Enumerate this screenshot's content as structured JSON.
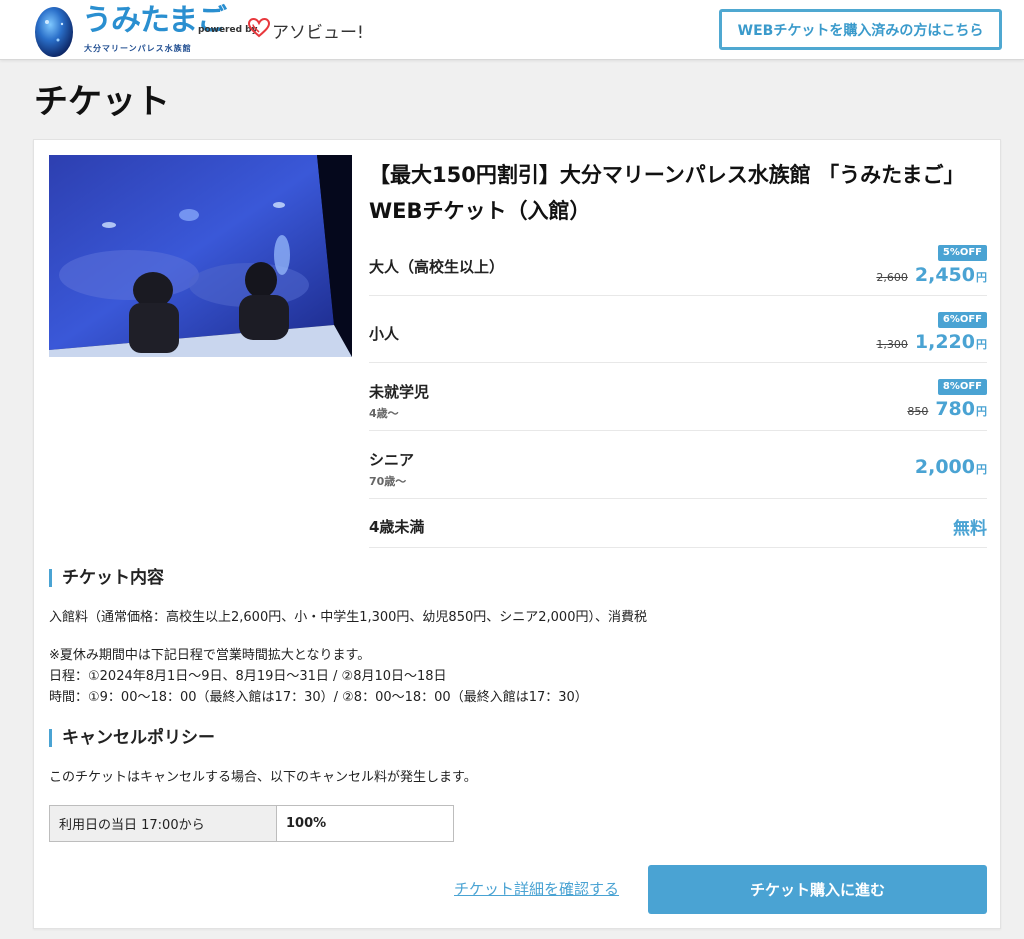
{
  "header": {
    "logo_text": "うみたまご",
    "logo_sub": "大分マリーンパレス水族館",
    "powered_by": "powered by",
    "asoview": "アソビュー!",
    "purchased_button": "WEBチケットを購入済みの方はこちら"
  },
  "page_title": "チケット",
  "product": {
    "title": "【最大150円割引】大分マリーンパレス水族館 「うみたまご」 WEBチケット（入館）",
    "prices": [
      {
        "label": "大人（高校生以上）",
        "sub": "",
        "badge": "5%OFF",
        "original": "2,600",
        "price": "2,450",
        "yen": "円"
      },
      {
        "label": "小人",
        "sub": "",
        "badge": "6%OFF",
        "original": "1,300",
        "price": "1,220",
        "yen": "円"
      },
      {
        "label": "未就学児",
        "sub": "4歳〜",
        "badge": "8%OFF",
        "original": "850",
        "price": "780",
        "yen": "円"
      },
      {
        "label": "シニア",
        "sub": "70歳〜",
        "badge": "",
        "original": "",
        "price": "2,000",
        "yen": "円"
      },
      {
        "label": "4歳未満",
        "sub": "",
        "badge": "",
        "original": "",
        "price": "無料",
        "yen": ""
      }
    ]
  },
  "ticket_contents": {
    "heading": "チケット内容",
    "line1": "入館料（通常価格：高校生以上2,600円、小・中学生1,300円、幼児850円、シニア2,000円）、消費税",
    "line2": "※夏休み期間中は下記日程で営業時間拡大となります。",
    "line3": "日程：①2024年8月1日〜9日、8月19日〜31日 / ②8月10日〜18日",
    "line4": "時間：①9：00〜18：00（最終入館は17：30）/ ②8：00〜18：00（最終入館は17：30）"
  },
  "cancel_policy": {
    "heading": "キャンセルポリシー",
    "text": "このチケットはキャンセルする場合、以下のキャンセル料が発生します。",
    "row_label": "利用日の当日 17:00から",
    "row_value": "100%"
  },
  "actions": {
    "detail_link": "チケット詳細を確認する",
    "buy_button": "チケット購入に進む"
  },
  "colors": {
    "accent": "#4aa3d3",
    "background": "#f0f0f0"
  }
}
